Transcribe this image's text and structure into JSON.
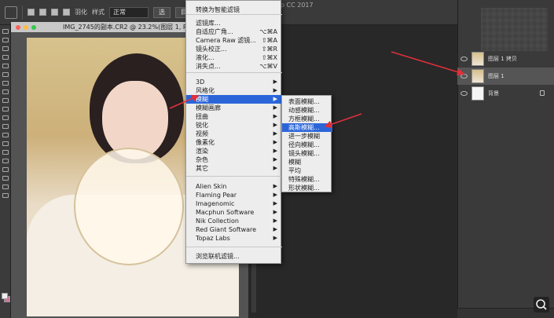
{
  "app": {
    "title": "op CC 2017"
  },
  "options_bar": {
    "feather_label": "羽化",
    "style_label": "样式",
    "style_value": "正常",
    "refine_label": "选",
    "mask_label": "目标"
  },
  "document": {
    "tab_title": "IMG_2745的副本.CR2 @ 23.2%(图层 1, RG"
  },
  "filter_menu": {
    "items": [
      {
        "label": "转换为智能滤镜",
        "shortcut": "",
        "submenu": false
      },
      {
        "label": "滤镜库...",
        "shortcut": "",
        "submenu": false
      },
      {
        "label": "自适应广角...",
        "shortcut": "⌥⌘A",
        "submenu": false
      },
      {
        "label": "Camera Raw 滤镜...",
        "shortcut": "⇧⌘A",
        "submenu": false
      },
      {
        "label": "镜头校正...",
        "shortcut": "⇧⌘R",
        "submenu": false
      },
      {
        "label": "液化...",
        "shortcut": "⇧⌘X",
        "submenu": false
      },
      {
        "label": "消失点...",
        "shortcut": "⌥⌘V",
        "submenu": false
      },
      {
        "label": "3D",
        "shortcut": "",
        "submenu": true
      },
      {
        "label": "风格化",
        "shortcut": "",
        "submenu": true
      },
      {
        "label": "模糊",
        "shortcut": "",
        "submenu": true,
        "highlighted": true
      },
      {
        "label": "模糊画廊",
        "shortcut": "",
        "submenu": true
      },
      {
        "label": "扭曲",
        "shortcut": "",
        "submenu": true
      },
      {
        "label": "锐化",
        "shortcut": "",
        "submenu": true
      },
      {
        "label": "视频",
        "shortcut": "",
        "submenu": true
      },
      {
        "label": "像素化",
        "shortcut": "",
        "submenu": true
      },
      {
        "label": "渲染",
        "shortcut": "",
        "submenu": true
      },
      {
        "label": "杂色",
        "shortcut": "",
        "submenu": true
      },
      {
        "label": "其它",
        "shortcut": "",
        "submenu": true
      },
      {
        "label": "Alien Skin",
        "shortcut": "",
        "submenu": true
      },
      {
        "label": "Flaming Pear",
        "shortcut": "",
        "submenu": true
      },
      {
        "label": "Imagenomic",
        "shortcut": "",
        "submenu": true
      },
      {
        "label": "Macphun Software",
        "shortcut": "",
        "submenu": true
      },
      {
        "label": "Nik Collection",
        "shortcut": "",
        "submenu": true
      },
      {
        "label": "Red Giant Software",
        "shortcut": "",
        "submenu": true
      },
      {
        "label": "Topaz Labs",
        "shortcut": "",
        "submenu": true
      },
      {
        "label": "浏览联机滤镜...",
        "shortcut": "",
        "submenu": false
      }
    ]
  },
  "blur_submenu": {
    "items": [
      {
        "label": "表面模糊..."
      },
      {
        "label": "动感模糊..."
      },
      {
        "label": "方框模糊..."
      },
      {
        "label": "高斯模糊...",
        "highlighted": true
      },
      {
        "label": "进一步模糊"
      },
      {
        "label": "径向模糊..."
      },
      {
        "label": "镜头模糊..."
      },
      {
        "label": "模糊"
      },
      {
        "label": "平均"
      },
      {
        "label": "特殊模糊..."
      },
      {
        "label": "形状模糊..."
      }
    ]
  },
  "layers": [
    {
      "name": "图层 1 拷贝",
      "selected": false,
      "locked": false
    },
    {
      "name": "图层 1",
      "selected": true,
      "locked": false
    },
    {
      "name": "背景",
      "selected": false,
      "locked": true
    }
  ],
  "colors": {
    "menu_highlight": "#2b66d9",
    "arrow": "#e0303a"
  }
}
